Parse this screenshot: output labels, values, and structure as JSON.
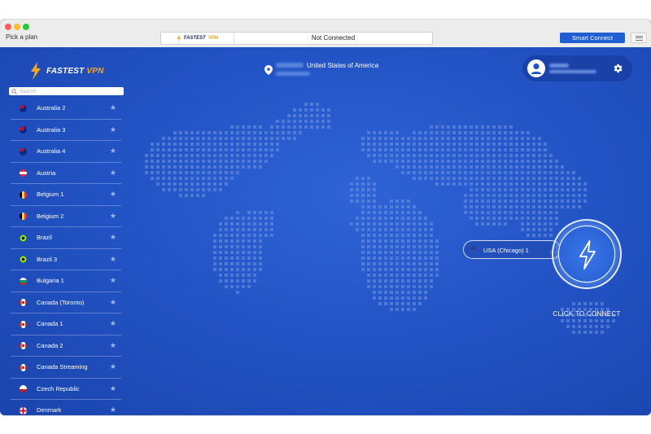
{
  "titlebar": {
    "pick_plan": "Pick a plan",
    "status_logo_part1": "FASTEST",
    "status_logo_part2": "VPN",
    "status": "Not Connected",
    "smart_connect": "Smart Connect"
  },
  "brand": {
    "part1": "FASTEST",
    "part2": "VPN"
  },
  "location": {
    "country": "United States of America"
  },
  "search": {
    "placeholder": "Search"
  },
  "servers": [
    {
      "name": "Australia 2",
      "flag": "australia"
    },
    {
      "name": "Australia 3",
      "flag": "australia"
    },
    {
      "name": "Australia 4",
      "flag": "australia"
    },
    {
      "name": "Austria",
      "flag": "austria"
    },
    {
      "name": "Belgium 1",
      "flag": "belgium"
    },
    {
      "name": "Belgium 2",
      "flag": "belgium"
    },
    {
      "name": "Brazil",
      "flag": "brazil"
    },
    {
      "name": "Brazil 3",
      "flag": "brazil"
    },
    {
      "name": "Bulgaria 1",
      "flag": "bulgaria"
    },
    {
      "name": "Canada (Toronto)",
      "flag": "canada"
    },
    {
      "name": "Canada 1",
      "flag": "canada"
    },
    {
      "name": "Canada 2",
      "flag": "canada"
    },
    {
      "name": "Canada Streaming",
      "flag": "canada"
    },
    {
      "name": "Czech Republic",
      "flag": "czech"
    },
    {
      "name": "Denmark",
      "flag": "denmark"
    }
  ],
  "selected_server": {
    "name": "USA (Chicago) 1",
    "flag": "usa"
  },
  "connect": {
    "label": "CLICK TO CONNECT"
  },
  "icons": {
    "star": "star-icon",
    "gear": "gear-icon",
    "avatar": "user-avatar-icon",
    "pin": "location-pin-icon",
    "bolt": "lightning-bolt-icon",
    "search": "search-icon"
  },
  "colors": {
    "primary_blue": "#2354c6",
    "accent_orange": "#f5a623",
    "button_blue": "#1f5fd1"
  }
}
